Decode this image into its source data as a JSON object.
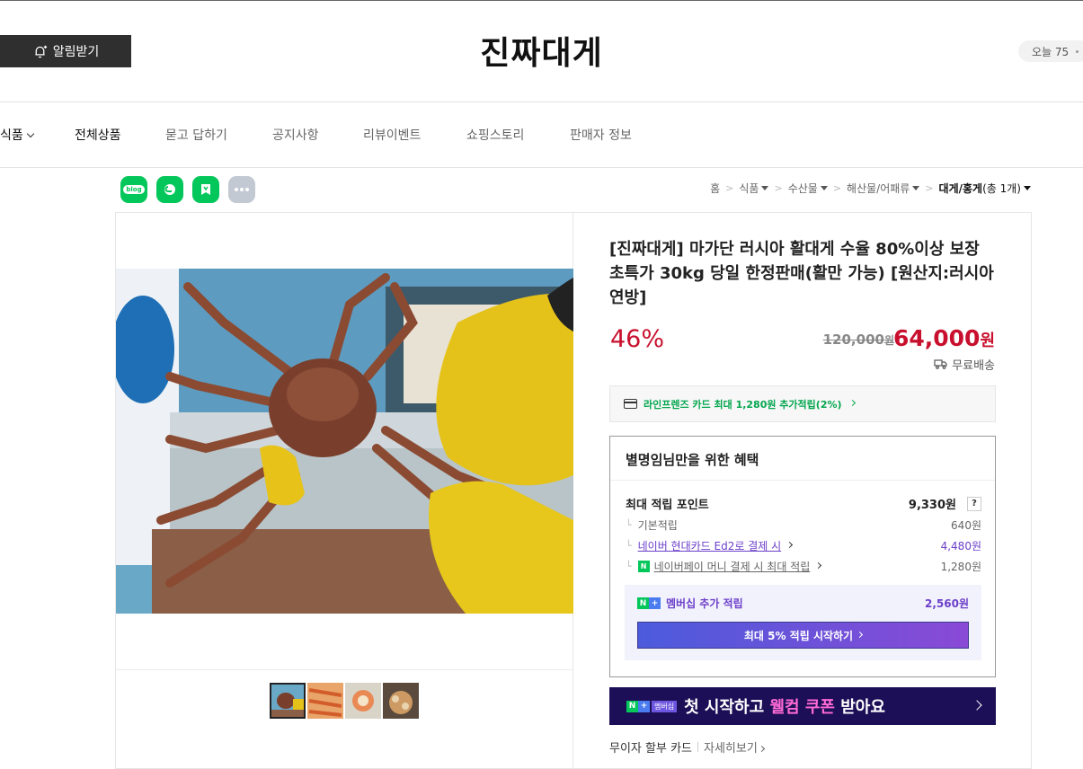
{
  "header": {
    "alarm_label": "알림받기",
    "store_title": "진짜대게",
    "today_label": "오늘 75"
  },
  "nav": {
    "items": [
      "식품",
      "전체상품",
      "묻고 답하기",
      "공지사항",
      "리뷰이벤트",
      "쇼핑스토리",
      "판매자 정보"
    ]
  },
  "share": {
    "blog_label": "blog",
    "icons": [
      "blog-icon",
      "cafe-icon",
      "keep-icon",
      "more-icon"
    ]
  },
  "breadcrumb": {
    "items": [
      "홈",
      "식품",
      "수산물",
      "해산물/어패류"
    ],
    "current": "대게/홍게",
    "count": "(총 1개)"
  },
  "product": {
    "title": "[진짜대게] 마가단 러시아 활대게 수율 80%이상 보장 초특가 30kg 당일 한정판매(활만 가능) [원산지:러시아연방]",
    "discount": "46%",
    "original_price": "120,000",
    "original_unit": "원",
    "sale_price": "64,000",
    "sale_unit": "원",
    "delivery": "무료배송",
    "thumbnail_count": 4,
    "selected_thumbnail": 0
  },
  "card_banner": {
    "text": "라인프렌즈 카드 최대 1,280원 추가적립(2%)"
  },
  "benefits": {
    "title": "별명임님만을 위한 혜택",
    "max_point_label": "최대 적립 포인트",
    "max_point_value": "9,330원",
    "help": "?",
    "rows": [
      {
        "label": "기본적립",
        "value": "640원"
      },
      {
        "label": "네이버 현대카드 Ed2로 결제 시",
        "value": "4,480원"
      },
      {
        "label": "네이버페이 머니 결제 시 최대 적립",
        "value": "1,280원"
      }
    ],
    "npay_badge": "N",
    "member_label": "멤버십 추가 적립",
    "member_value": "2,560원",
    "member_button": "최대 5% 적립 시작하기"
  },
  "promo": {
    "badge_n": "N",
    "badge_plus": "+",
    "badge_mb": "멤버십",
    "text_a": "첫 시작하고 ",
    "text_hl": "웰컴 쿠폰",
    "text_b": " 받아요"
  },
  "installment": {
    "label": "무이자 할부 카드",
    "more": "자세히보기"
  },
  "colors": {
    "accent_red": "#c8102e",
    "naver_green": "#03c75a",
    "membership_purple": "#6b3fc9",
    "promo_bg": "#1d0f57"
  }
}
